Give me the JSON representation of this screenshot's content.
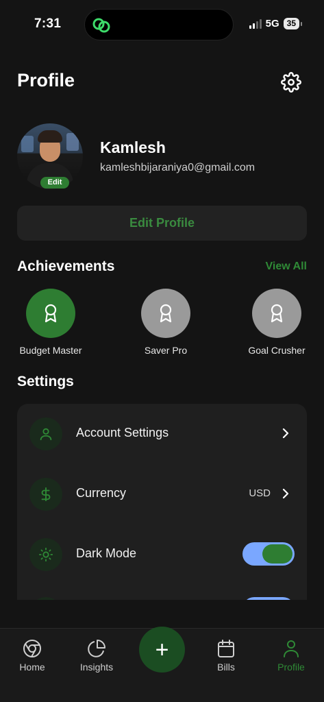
{
  "status_bar": {
    "time": "7:31",
    "network": "5G",
    "battery": "35"
  },
  "header": {
    "title": "Profile"
  },
  "profile": {
    "name": "Kamlesh",
    "email": "kamleshbijaraniya0@gmail.com",
    "avatar_edit_label": "Edit",
    "edit_profile_label": "Edit Profile"
  },
  "achievements": {
    "title": "Achievements",
    "view_all_label": "View All",
    "items": [
      {
        "label": "Budget Master",
        "state": "earned"
      },
      {
        "label": "Saver Pro",
        "state": "locked"
      },
      {
        "label": "Goal Crusher",
        "state": "locked"
      }
    ]
  },
  "settings": {
    "title": "Settings",
    "items": [
      {
        "label": "Account Settings",
        "icon": "user-icon",
        "control": "chevron"
      },
      {
        "label": "Currency",
        "icon": "dollar-icon",
        "value": "USD",
        "control": "chevron"
      },
      {
        "label": "Dark Mode",
        "icon": "sun-icon",
        "control": "toggle",
        "on": true
      }
    ]
  },
  "tab_bar": {
    "items": [
      {
        "label": "Home",
        "icon": "chrome-home-icon",
        "active": false
      },
      {
        "label": "Insights",
        "icon": "pie-chart-icon",
        "active": false
      },
      {
        "label": "Bills",
        "icon": "calendar-icon",
        "active": false
      },
      {
        "label": "Profile",
        "icon": "user-icon",
        "active": true
      }
    ],
    "fab_label": "+"
  },
  "colors": {
    "accent": "#2e7d32",
    "accent_text": "#2f8a36",
    "background": "#141414",
    "card": "#1f1f1f",
    "toggle_track": "#7aa7ff"
  }
}
